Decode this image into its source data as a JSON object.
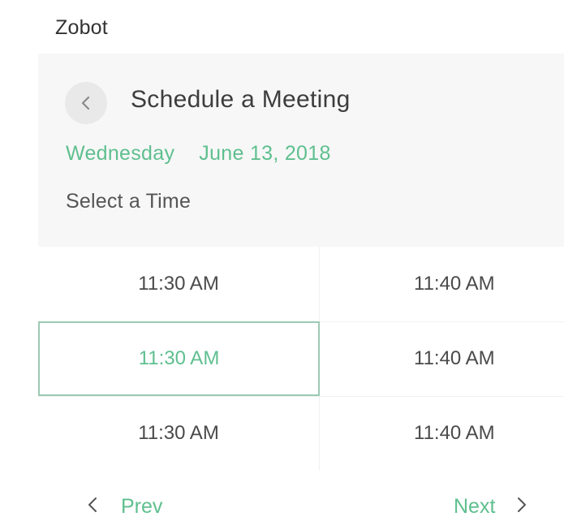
{
  "app": {
    "name": "Zobot"
  },
  "header": {
    "back_icon": "chevron-left-icon",
    "title": "Schedule a Meeting",
    "weekday": "Wednesday",
    "date": "June 13, 2018",
    "subtitle": "Select a Time"
  },
  "colors": {
    "accent": "#5fbf8f",
    "header_bg": "#f7f7f7",
    "selected_border": "#9cc9b3"
  },
  "slots": [
    {
      "left": "11:30 AM",
      "right": "11:40 AM"
    },
    {
      "left": "11:30 AM",
      "right": "11:40 AM",
      "selected": "left"
    },
    {
      "left": "11:30 AM",
      "right": "11:40 AM"
    }
  ],
  "pager": {
    "prev_label": "Prev",
    "next_label": "Next",
    "prev_icon": "chevron-left-icon",
    "next_icon": "chevron-right-icon"
  }
}
